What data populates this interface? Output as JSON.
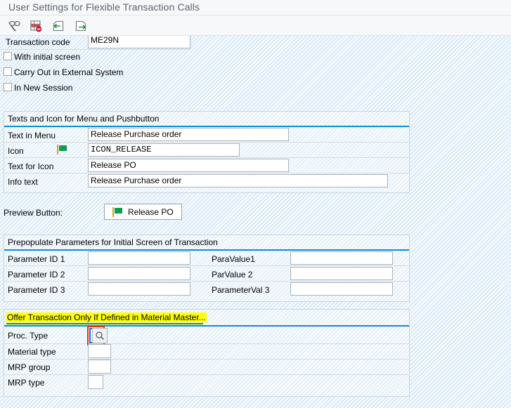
{
  "window": {
    "title": "User Settings for Flexible Transaction Calls"
  },
  "toolbar": {
    "buttons": [
      {
        "name": "display-check-icon",
        "label": "Check"
      },
      {
        "name": "delete-row-icon",
        "label": "Delete Row"
      },
      {
        "name": "back-arrow-icon",
        "label": "Back"
      },
      {
        "name": "exit-arrow-icon",
        "label": "Exit"
      }
    ]
  },
  "transaction": {
    "code_label": "Transaction code",
    "code_value": "ME29N",
    "checkboxes": [
      {
        "label": "With initial screen",
        "checked": false
      },
      {
        "label": "Carry Out in External System",
        "checked": false
      },
      {
        "label": "In New Session",
        "checked": false
      }
    ]
  },
  "texts_icon_group": {
    "title": "Texts and Icon for Menu and Pushbutton",
    "rows": [
      {
        "label": "Text in Menu",
        "value": "Release Purchase order"
      },
      {
        "label": "Icon",
        "value": "ICON_RELEASE"
      },
      {
        "label": "Text for Icon",
        "value": "Release PO"
      },
      {
        "label": "Info text",
        "value": "Release Purchase order"
      }
    ],
    "icon_name": "release-flag-icon"
  },
  "preview": {
    "label": "Preview Button:",
    "button_label": "Release PO",
    "button_icon": "release-flag-icon"
  },
  "prepopulate_group": {
    "title": "Prepopulate Parameters for Initial Screen of Transaction",
    "rows": [
      {
        "id_label": "Parameter ID 1",
        "id_value": "",
        "val_label": "ParaValue1",
        "val_value": ""
      },
      {
        "id_label": "Parameter ID 2",
        "id_value": "",
        "val_label": "ParValue 2",
        "val_value": ""
      },
      {
        "id_label": "Parameter ID 3",
        "id_value": "",
        "val_label": "ParameterVal 3",
        "val_value": ""
      }
    ]
  },
  "material_master_group": {
    "title": "Offer Transaction Only If Defined in Material Master...",
    "rows": [
      {
        "label": "Proc. Type",
        "value": "",
        "focused": true,
        "has_f4": true
      },
      {
        "label": "Material type",
        "value": "",
        "focused": false,
        "has_f4": false
      },
      {
        "label": "MRP group",
        "value": "",
        "focused": false,
        "has_f4": false
      },
      {
        "label": "MRP type",
        "value": "",
        "focused": false,
        "has_f4": false
      }
    ]
  },
  "colors": {
    "accent_rule": "#0a8ed9",
    "green_rule": "#179c17",
    "highlight": "#ffff00",
    "focus_marker": "#e03127",
    "flag_green": "#0f9d4f"
  }
}
